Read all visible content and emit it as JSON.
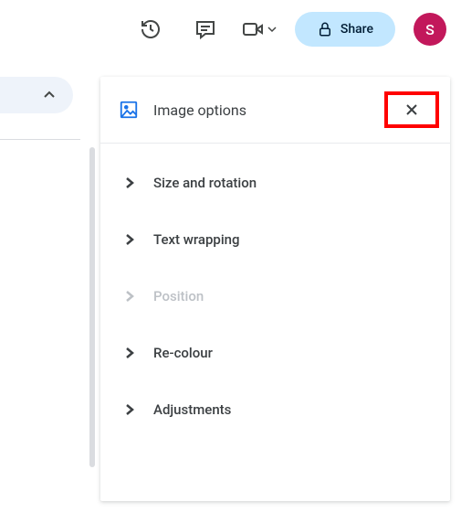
{
  "topbar": {
    "share_label": "Share",
    "avatar_letter": "S"
  },
  "panel": {
    "title": "Image options",
    "sections": {
      "size": "Size and rotation",
      "wrap": "Text wrapping",
      "position": "Position",
      "recolour": "Re-colour",
      "adjustments": "Adjustments"
    }
  }
}
